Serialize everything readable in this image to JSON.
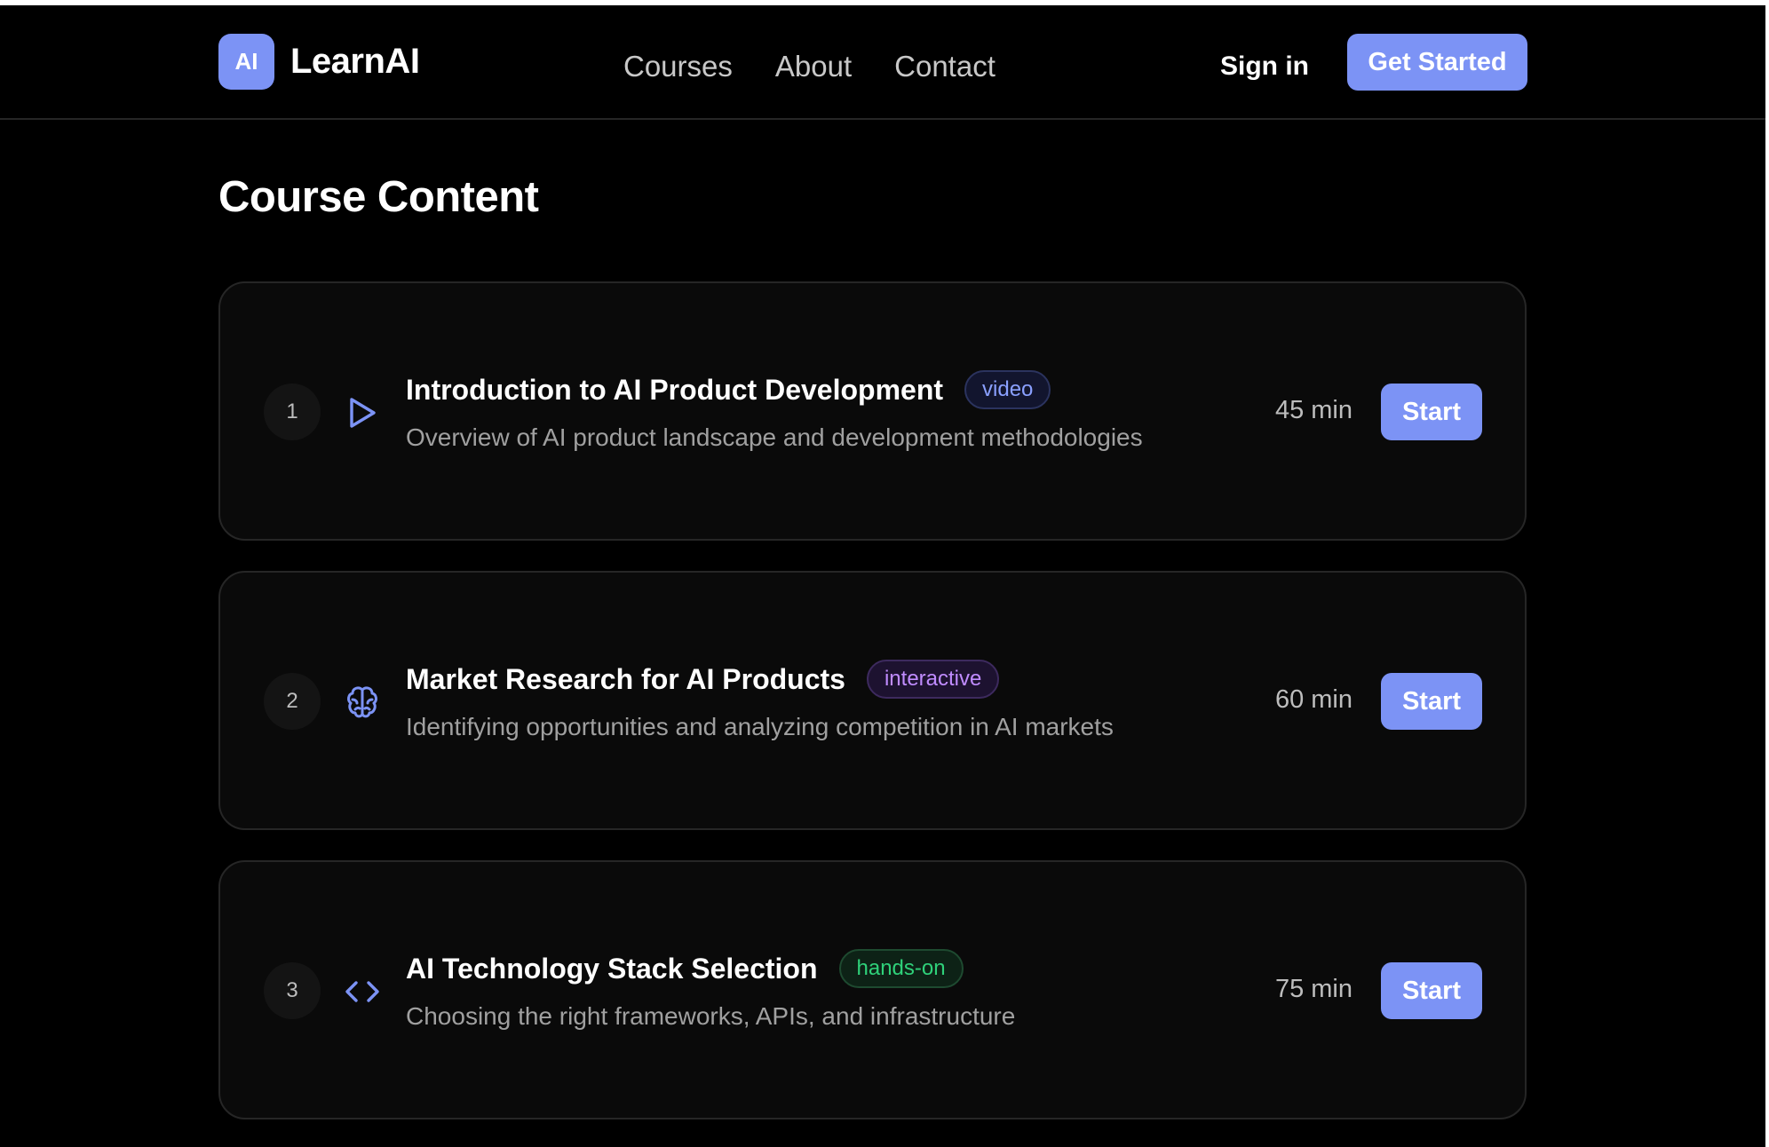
{
  "header": {
    "logo_badge": "AI",
    "logo_text": "LearnAI",
    "nav": [
      "Courses",
      "About",
      "Contact"
    ],
    "sign_in": "Sign in",
    "get_started": "Get Started"
  },
  "main": {
    "title": "Course Content",
    "lessons": [
      {
        "number": "1",
        "icon": "play-icon",
        "title": "Introduction to AI Product Development",
        "badge": "video",
        "description": "Overview of AI product landscape and development methodologies",
        "duration": "45 min",
        "action": "Start"
      },
      {
        "number": "2",
        "icon": "brain-icon",
        "title": "Market Research for AI Products",
        "badge": "interactive",
        "description": "Identifying opportunities and analyzing competition in AI markets",
        "duration": "60 min",
        "action": "Start"
      },
      {
        "number": "3",
        "icon": "code-icon",
        "title": "AI Technology Stack Selection",
        "badge": "hands-on",
        "description": "Choosing the right frameworks, APIs, and infrastructure",
        "duration": "75 min",
        "action": "Start"
      }
    ]
  },
  "colors": {
    "accent": "#7c93f5",
    "background": "#000000",
    "card": "#0a0a0a",
    "video_badge": "#8aa0ff",
    "interactive_badge": "#c08cff",
    "hands_on_badge": "#2fd17a"
  }
}
